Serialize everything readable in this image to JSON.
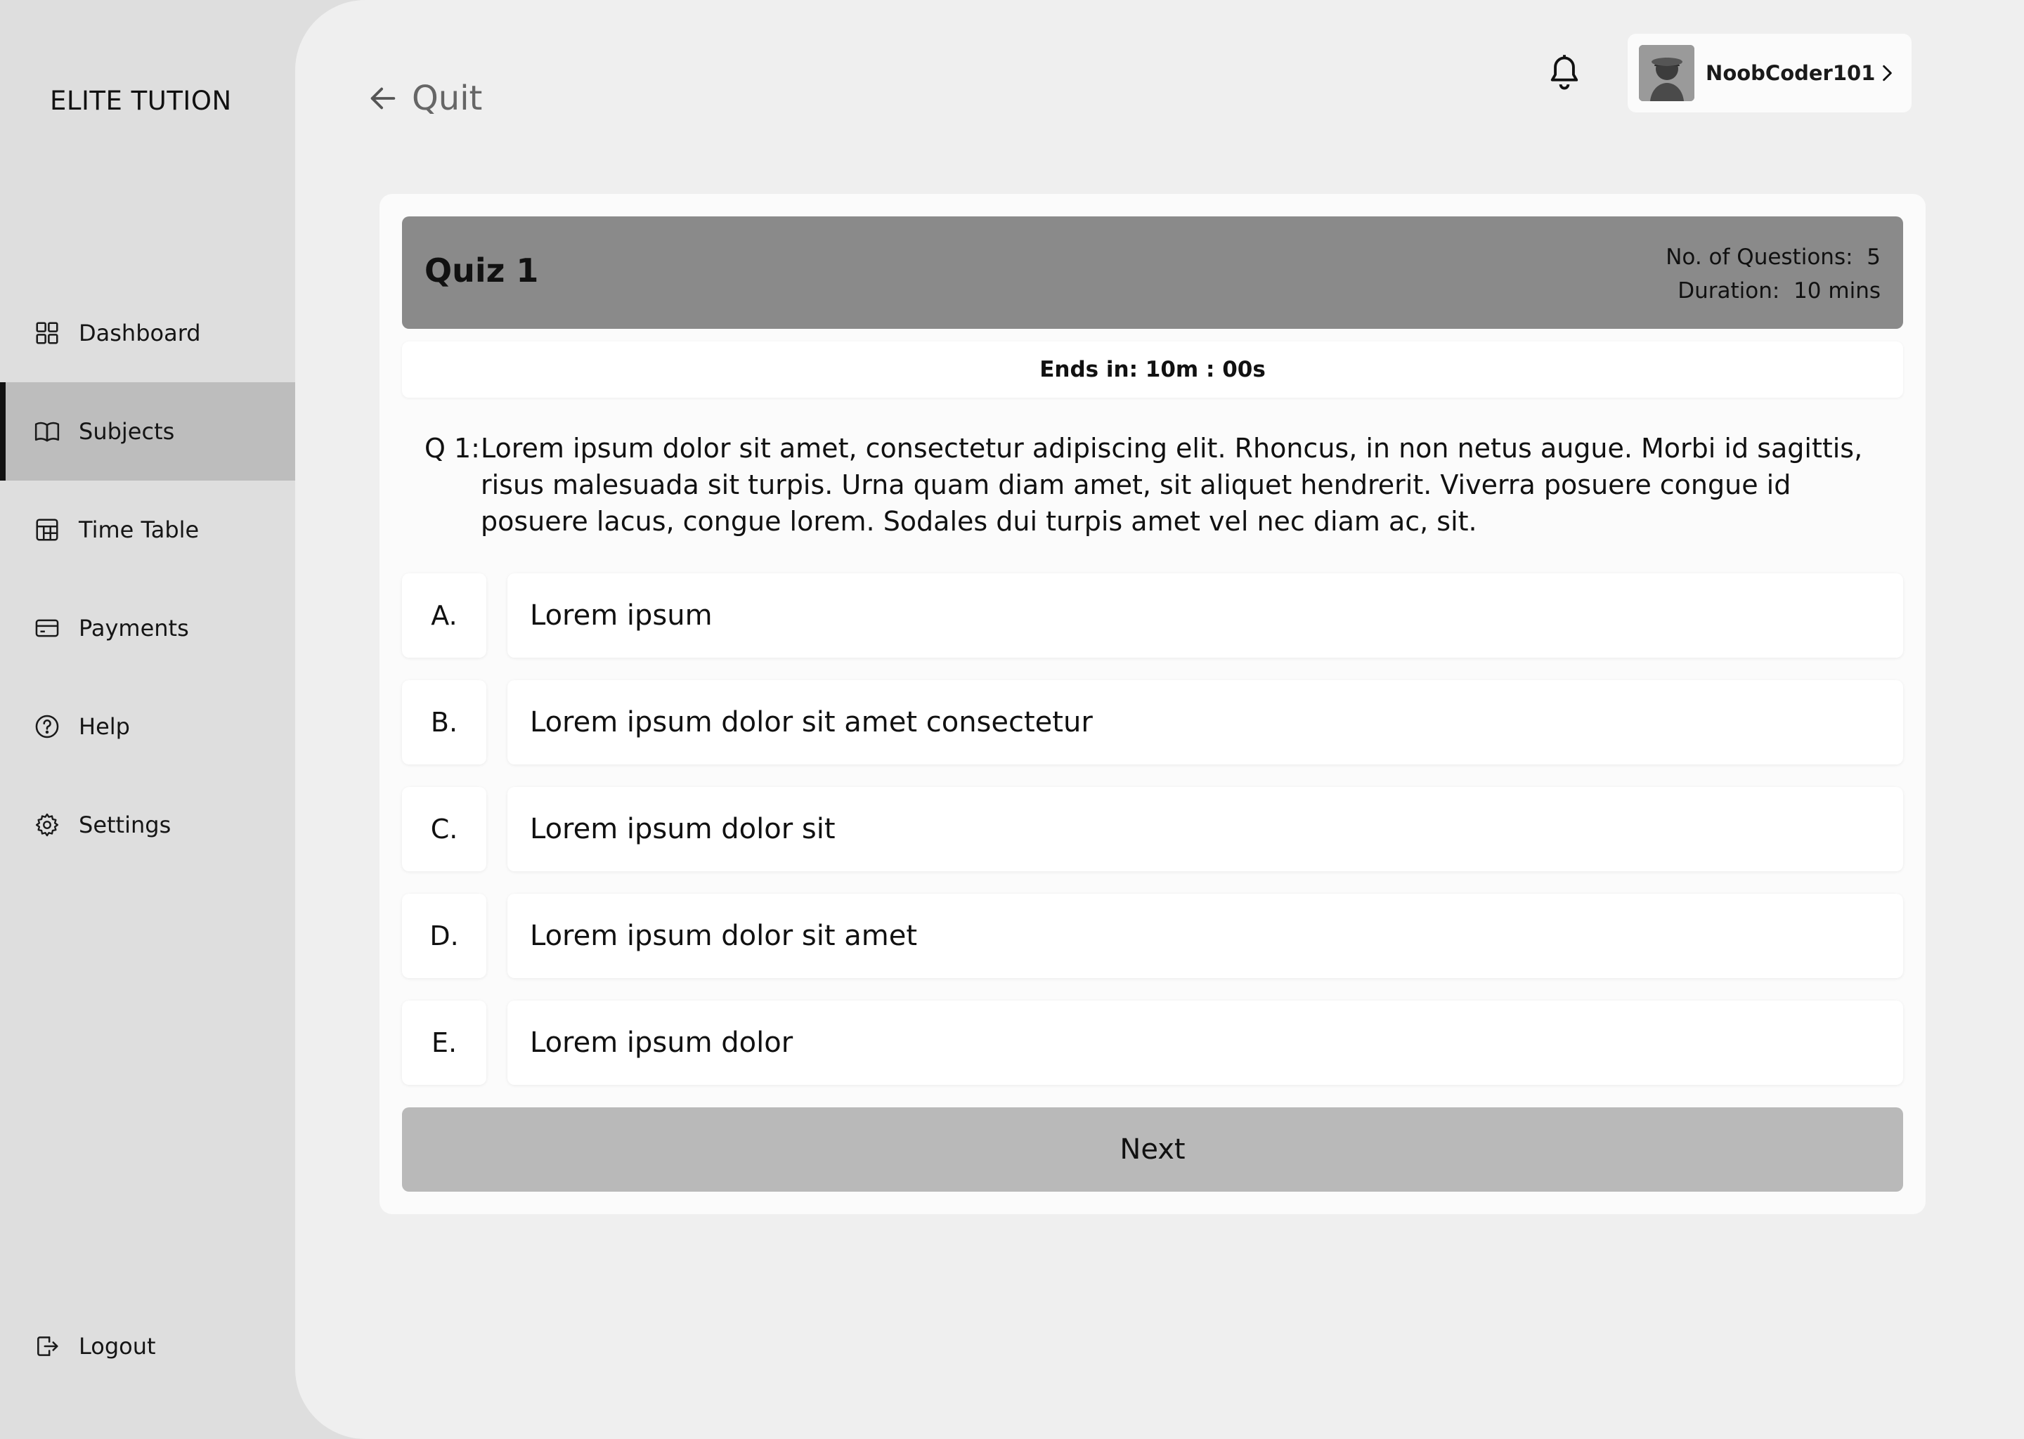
{
  "brand": "ELITE TUTION",
  "sidebar": {
    "items": [
      {
        "label": "Dashboard",
        "icon": "grid-icon"
      },
      {
        "label": "Subjects",
        "icon": "book-icon",
        "active": true
      },
      {
        "label": "Time Table",
        "icon": "table-icon"
      },
      {
        "label": "Payments",
        "icon": "credit-card-icon"
      },
      {
        "label": "Help",
        "icon": "help-circle-icon"
      },
      {
        "label": "Settings",
        "icon": "gear-icon"
      }
    ],
    "logout": {
      "label": "Logout",
      "icon": "logout-icon"
    }
  },
  "header": {
    "quit_label": "Quit",
    "username": "NoobCoder101"
  },
  "quiz": {
    "title": "Quiz 1",
    "questions_label": "No. of Questions:",
    "questions_count": "5",
    "duration_label": "Duration:",
    "duration_value": "10 mins",
    "timer_label": "Ends in:",
    "timer_value": "10m : 00s",
    "question_prefix": "Q 1:",
    "question_text": "Lorem ipsum dolor sit amet, consectetur adipiscing elit. Rhoncus, in non netus augue. Morbi id sagittis, risus malesuada sit turpis. Urna quam diam amet, sit aliquet hendrerit. Viverra posuere congue id posuere lacus, congue lorem. Sodales dui turpis amet vel nec diam ac, sit.",
    "options": [
      {
        "letter": "A.",
        "text": "Lorem ipsum"
      },
      {
        "letter": "B.",
        "text": "Lorem ipsum dolor sit amet consectetur"
      },
      {
        "letter": "C.",
        "text": "Lorem ipsum dolor sit"
      },
      {
        "letter": "D.",
        "text": "Lorem ipsum dolor sit amet"
      },
      {
        "letter": "E.",
        "text": "Lorem ipsum dolor"
      }
    ],
    "next_label": "Next"
  },
  "colors": {
    "sidebar_bg": "#dedede",
    "main_bg": "#efefef",
    "active_nav_bg": "#bdbdbd",
    "header_bg": "#8a8a8a",
    "next_bg": "#b9b9b9"
  }
}
